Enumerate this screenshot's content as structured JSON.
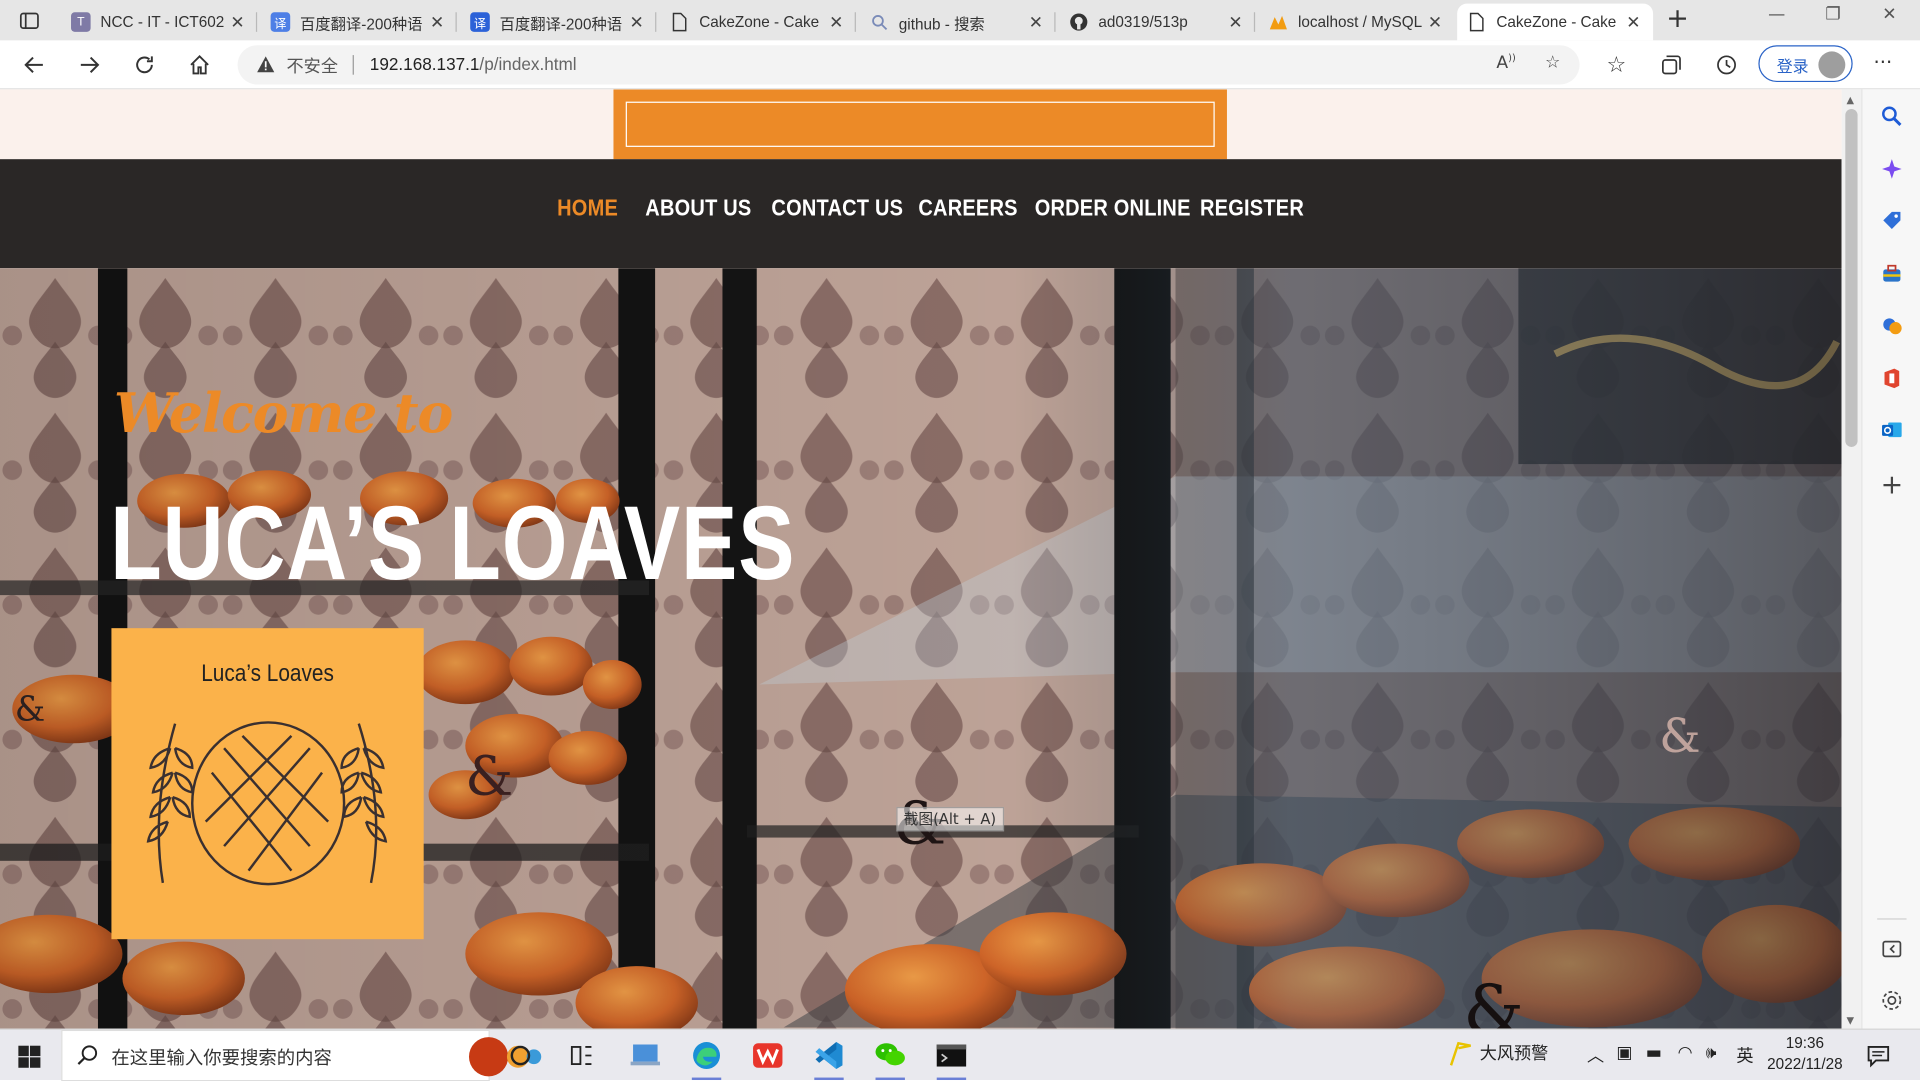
{
  "browser": {
    "tabs": [
      {
        "title": "NCC - IT - ICT602",
        "favicon": "ncc-favicon-icon",
        "active": false
      },
      {
        "title": "百度翻译-200种语",
        "favicon": "baidu-translate-icon",
        "active": false
      },
      {
        "title": "百度翻译-200种语",
        "favicon": "baidu-translate-icon",
        "active": false
      },
      {
        "title": "CakeZone - Cake",
        "favicon": "page-icon",
        "active": false
      },
      {
        "title": "github - 搜索",
        "favicon": "search-icon",
        "active": false
      },
      {
        "title": "ad0319/513p",
        "favicon": "github-icon",
        "active": false
      },
      {
        "title": "localhost / MySQL",
        "favicon": "phpmyadmin-icon",
        "active": false
      },
      {
        "title": "CakeZone - Cake",
        "favicon": "page-icon",
        "active": true
      }
    ],
    "insecure_label": "不安全",
    "url_host": "192.168.137.1",
    "url_path": "/p/index.html",
    "login_label": "登录"
  },
  "site": {
    "search": {
      "value": "",
      "placeholder": ""
    },
    "menu": [
      {
        "label": "HOME",
        "active": true
      },
      {
        "label": "ABOUT US",
        "active": false
      },
      {
        "label": "CONTACT US",
        "active": false
      },
      {
        "label": "CAREERS",
        "active": false
      },
      {
        "label": "ORDER ONLINE",
        "active": false
      },
      {
        "label": "REGISTER",
        "active": false
      }
    ],
    "hero": {
      "welcome": "Welcome to",
      "title": "LUCA’S LOAVES",
      "logo_text": "Luca’s Loaves"
    },
    "tooltip": "截图(Alt + A)"
  },
  "taskbar": {
    "search_placeholder": "在这里输入你要搜索的内容",
    "weather": "大风预警",
    "ime": "英",
    "time": "19:36",
    "date": "2022/11/28"
  },
  "colors": {
    "accent": "#ec8a27",
    "menu_bg": "#2a2726",
    "logo_bg": "#fbb24a",
    "page_top_bg": "#fbf1ec"
  }
}
